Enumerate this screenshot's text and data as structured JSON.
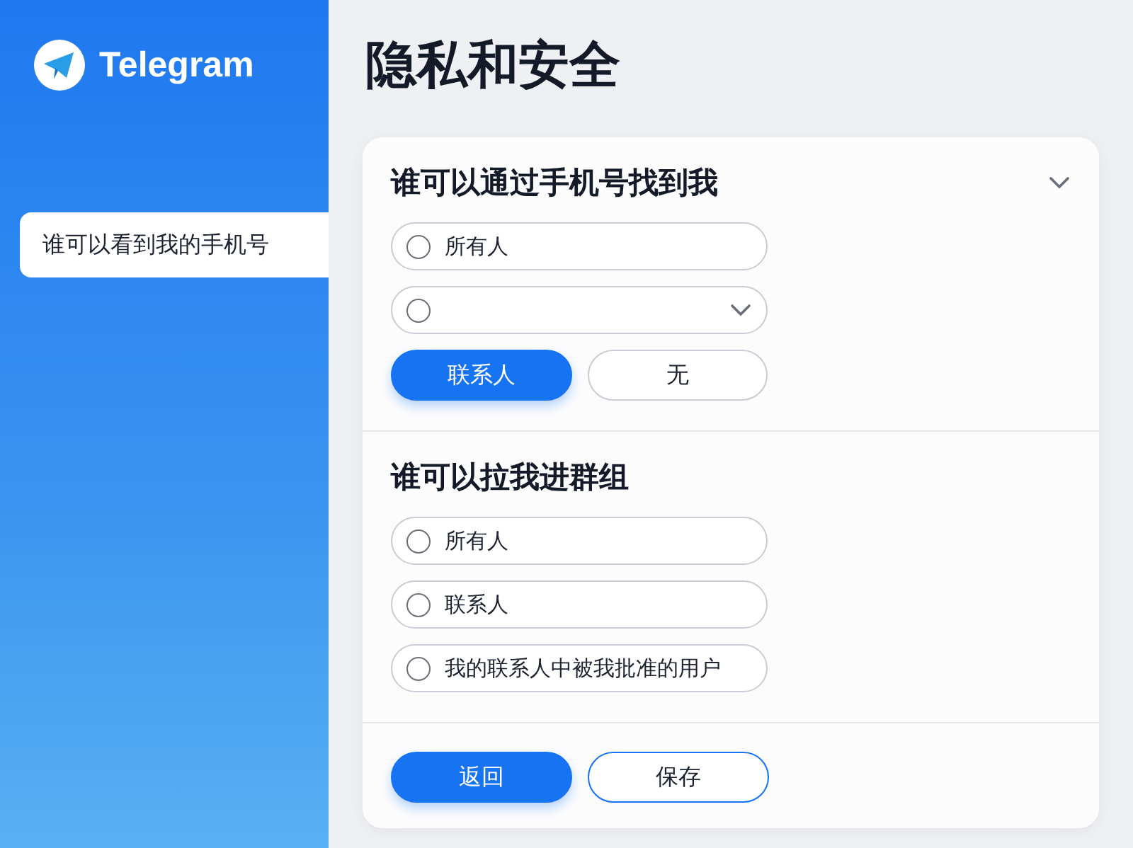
{
  "sidebar": {
    "app_name": "Telegram",
    "items": [
      {
        "label": "谁可以看到我的手机号",
        "selected": true
      }
    ]
  },
  "title": "隐私和安全",
  "sections": [
    {
      "heading": "谁可以通过手机号找到我",
      "options": [
        {
          "kind": "radio",
          "label": "所有人",
          "checked": false
        },
        {
          "kind": "dropdown",
          "checked": false
        }
      ],
      "choices": [
        {
          "label": "联系人",
          "selected": true
        },
        {
          "label": "无",
          "selected": false
        }
      ]
    },
    {
      "heading": "谁可以拉我进群组",
      "options": [
        {
          "kind": "radio",
          "label": "所有人",
          "checked": false
        },
        {
          "kind": "radio",
          "label": "联系人",
          "checked": false
        },
        {
          "kind": "radio",
          "label": "我的联系人中被我批准的用户",
          "checked": false
        }
      ]
    }
  ],
  "footer_buttons": [
    {
      "label": "返回",
      "primary": true
    },
    {
      "label": "保存",
      "primary": false
    }
  ]
}
